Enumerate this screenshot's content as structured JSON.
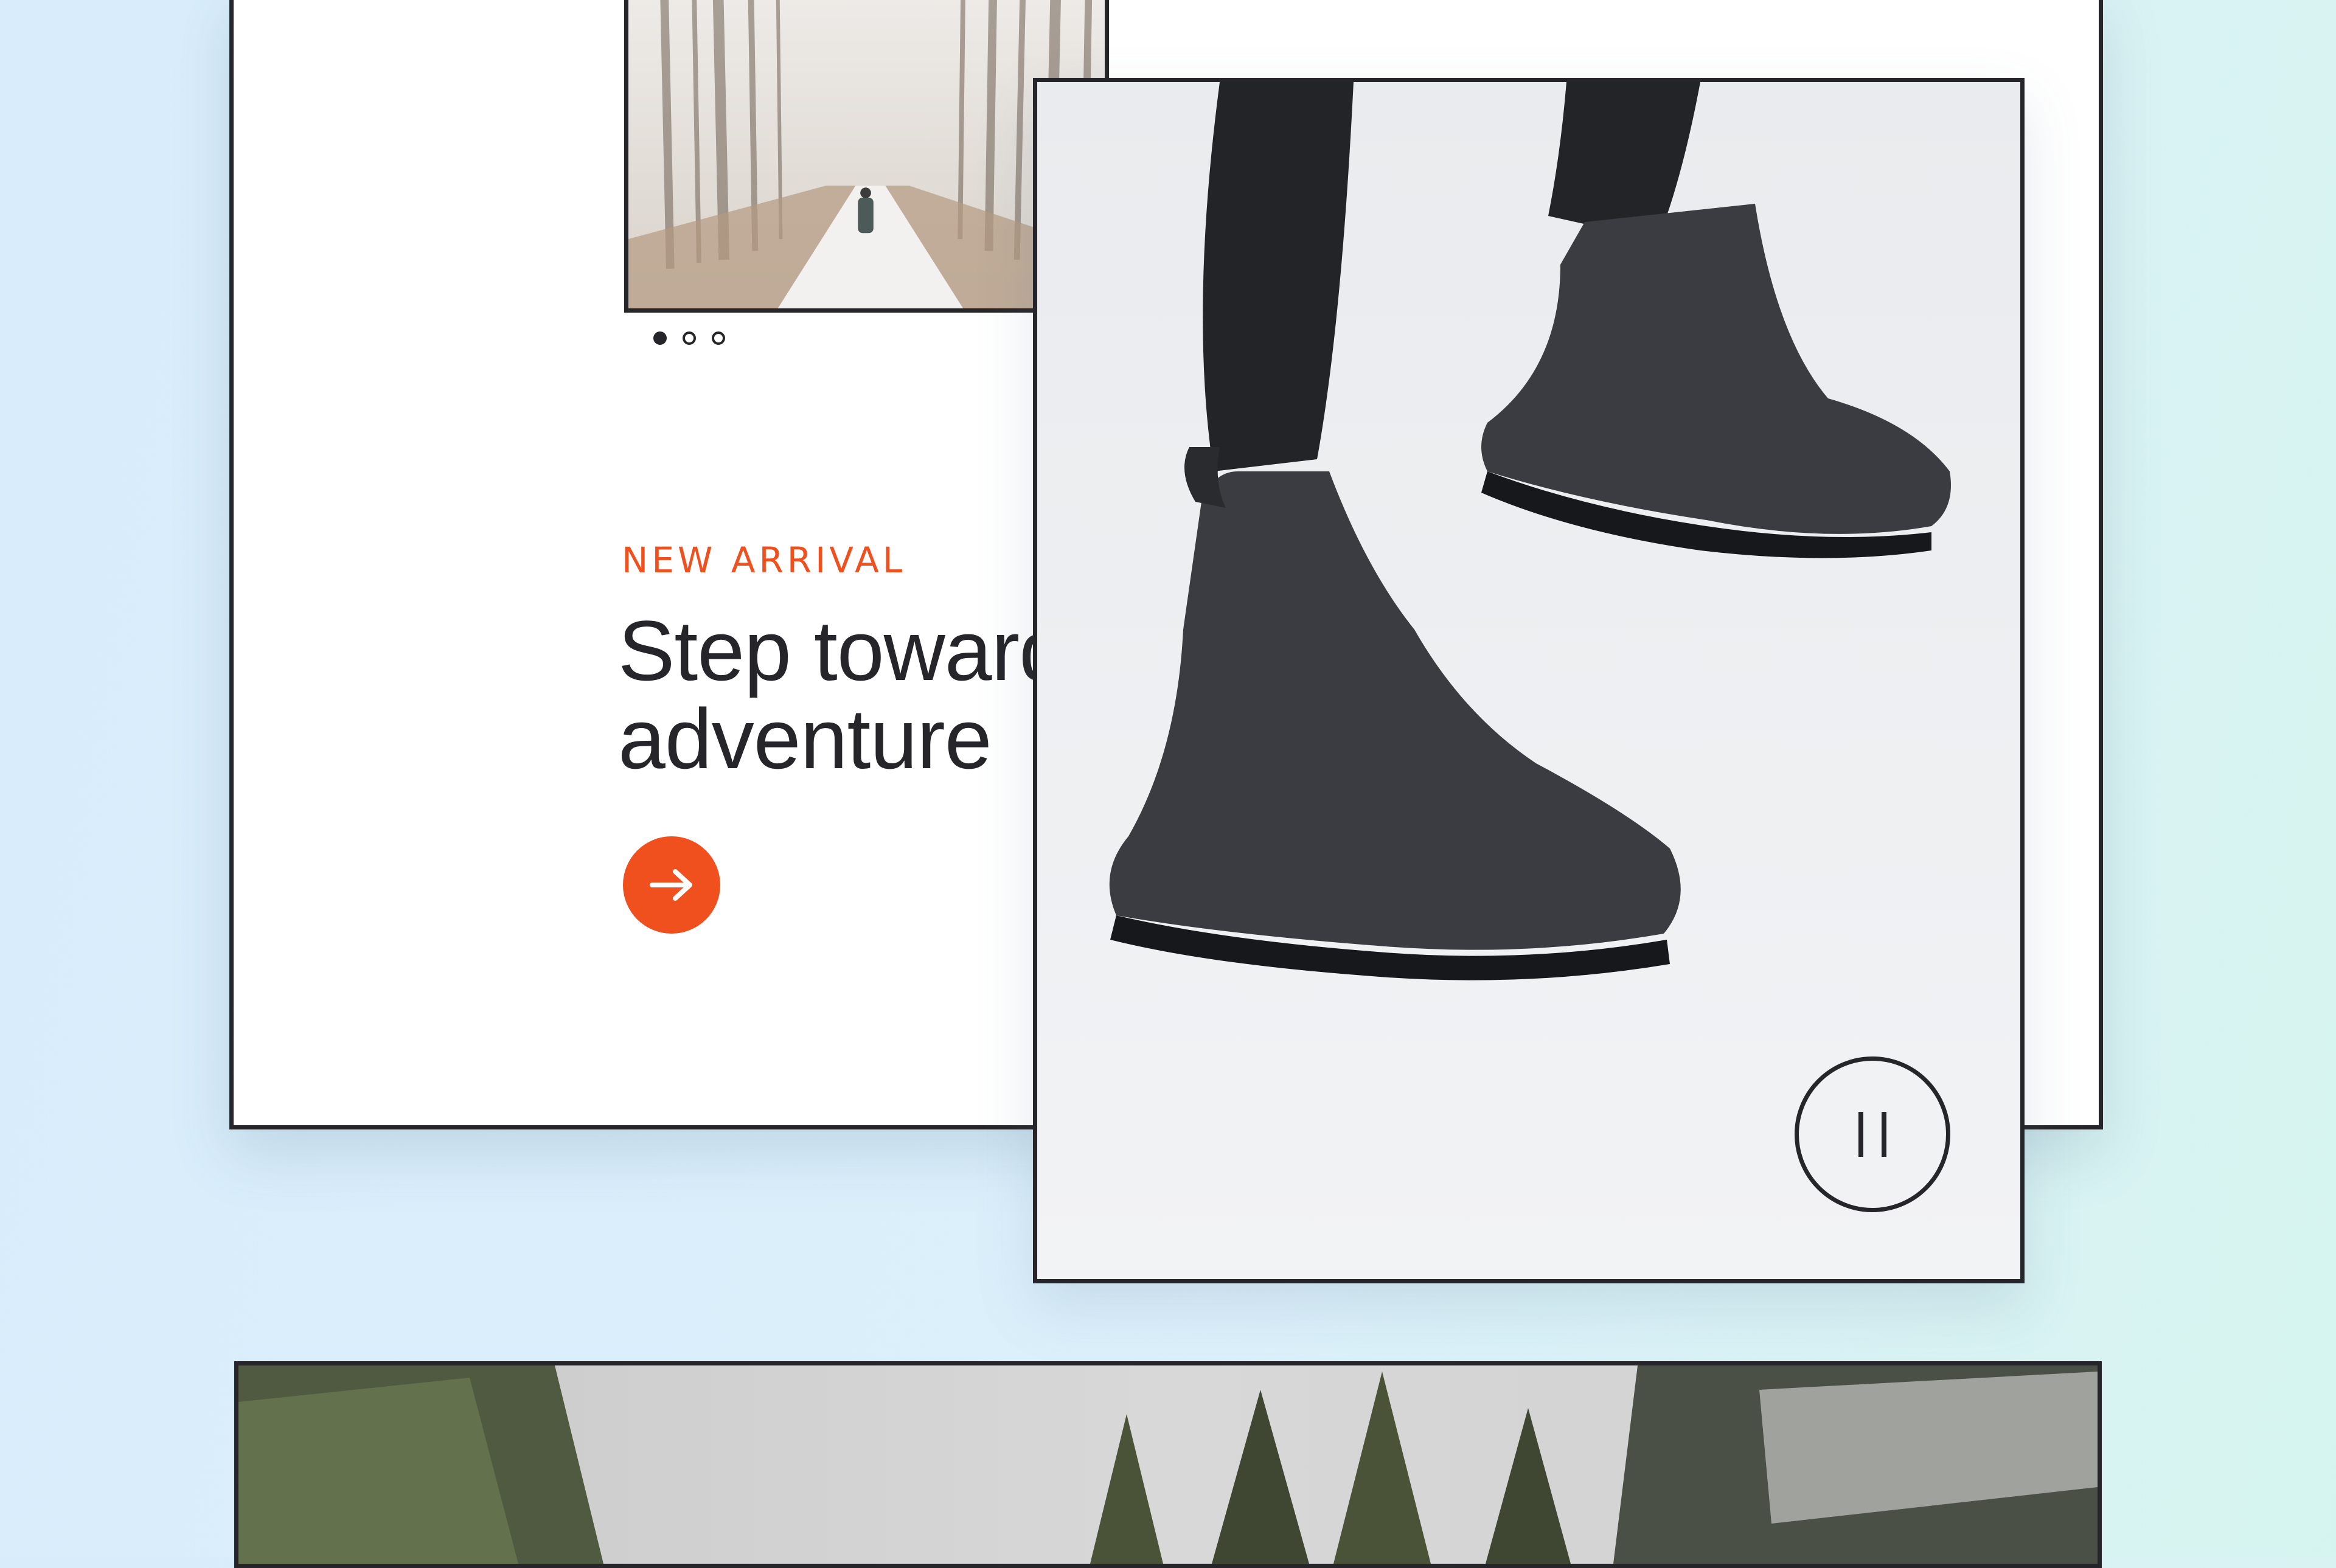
{
  "promo": {
    "eyebrow": "NEW ARRIVAL",
    "headline": "Step toward adventure",
    "accent_color": "#f0501e",
    "ink_color": "#26262a",
    "cta_icon": "arrow-right-icon"
  },
  "carousel": {
    "slide_count": 3,
    "active_index": 0
  },
  "hero": {
    "control_icon": "pause-icon"
  }
}
